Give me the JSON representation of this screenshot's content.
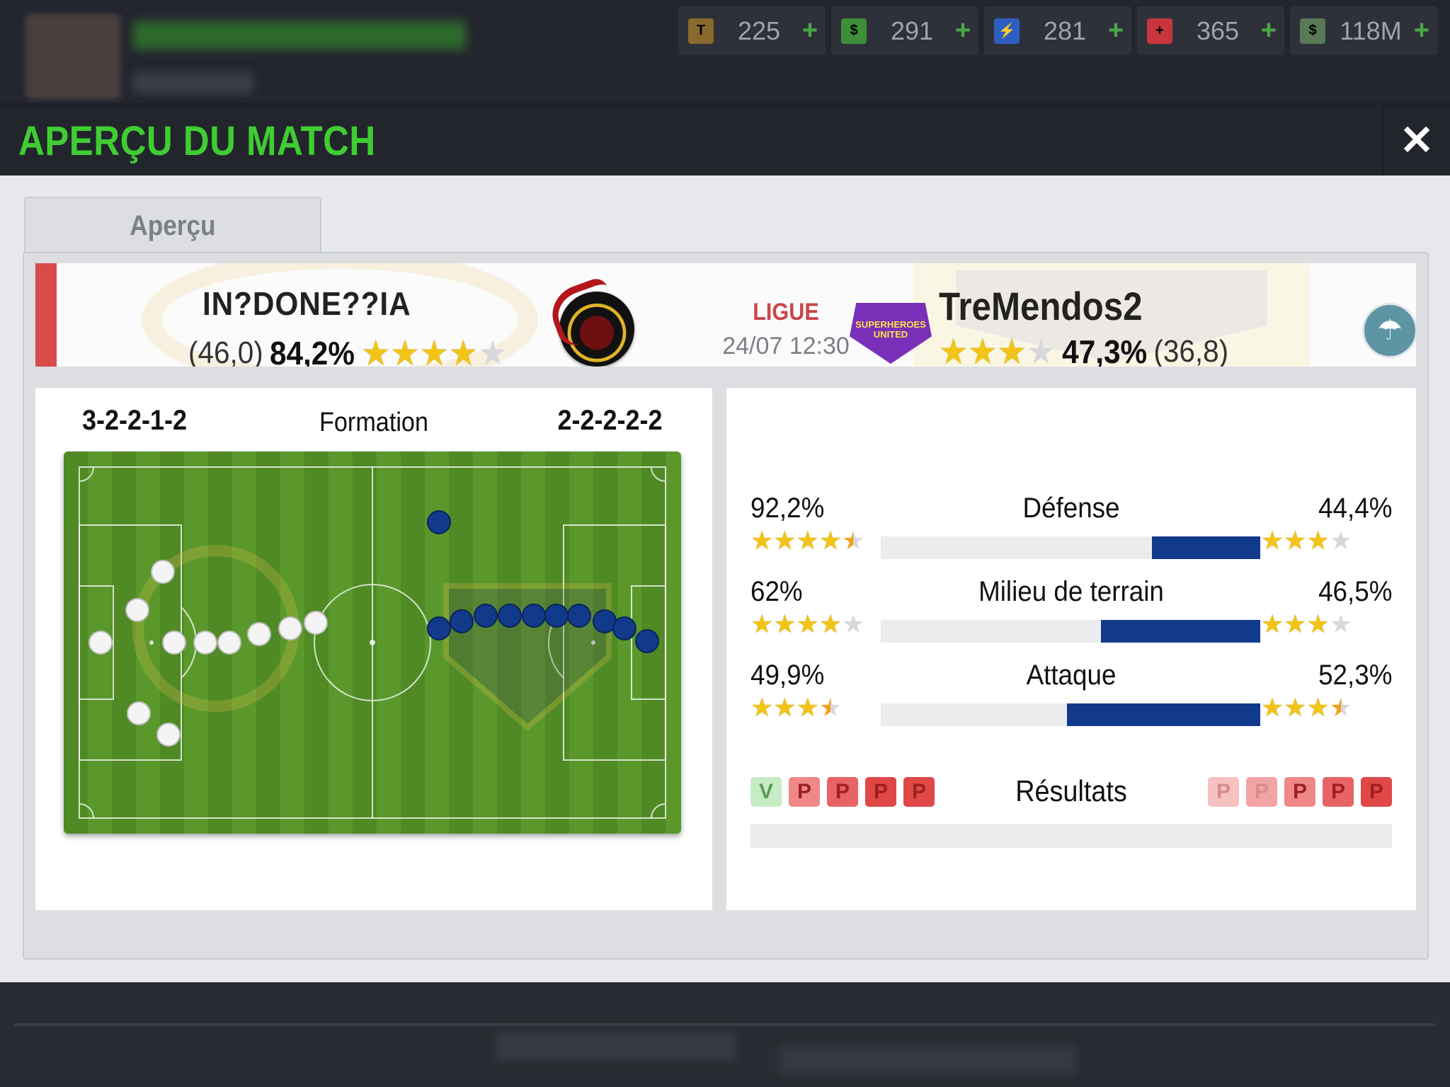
{
  "topbar": {
    "resources": [
      {
        "icon": "token-coin-icon",
        "value": "225",
        "color": "#8a6a2c",
        "glyph": "T"
      },
      {
        "icon": "cash-icon",
        "value": "291",
        "color": "#3f8f3a",
        "glyph": "$"
      },
      {
        "icon": "energy-icon",
        "value": "281",
        "color": "#2e5ec2",
        "glyph": "⚡"
      },
      {
        "icon": "medical-icon",
        "value": "365",
        "color": "#c8363b",
        "glyph": "+"
      },
      {
        "icon": "money-bag-icon",
        "value": "118M",
        "color": "#587a56",
        "glyph": "$"
      }
    ],
    "plus": "+"
  },
  "modal": {
    "title": "APERÇU DU MATCH",
    "close_symbol": "✕",
    "tab_label": "Aperçu"
  },
  "match": {
    "home": {
      "name": "IN?DONE??IA",
      "rating": "(46,0)",
      "percent": "84,2%",
      "stars": 4.0,
      "stars_max": 5,
      "formation": "3-2-2-1-2"
    },
    "competition": "LIGUE",
    "datetime": "24/07 12:30",
    "away": {
      "name": "TreMendos2",
      "logo_text": "SUPERHEROES UNITED",
      "rating": "(36,8)",
      "percent": "47,3%",
      "stars": 3.0,
      "stars_max": 4,
      "formation": "2-2-2-2-2"
    },
    "weather_icon": "rain-cloud-icon"
  },
  "formation_label": "Formation",
  "stats": [
    {
      "label": "Défense",
      "home": "92,2%",
      "away": "44,4%",
      "home_stars": 4.5,
      "home_max": 5,
      "away_stars": 3.0,
      "away_max": 4,
      "away_share": 0.285
    },
    {
      "label": "Milieu de terrain",
      "home": "62%",
      "away": "46,5%",
      "home_stars": 4.0,
      "home_max": 5,
      "away_stars": 3.0,
      "away_max": 4,
      "away_share": 0.42
    },
    {
      "label": "Attaque",
      "home": "49,9%",
      "away": "52,3%",
      "home_stars": 3.5,
      "home_max": 4,
      "away_stars": 3.5,
      "away_max": 4,
      "away_share": 0.51
    }
  ],
  "results": {
    "label": "Résultats",
    "home": [
      "V",
      "P",
      "P",
      "P",
      "P"
    ],
    "away": [
      "P",
      "P",
      "P",
      "P",
      "P"
    ]
  },
  "colors": {
    "accent_green": "#3fcd32",
    "home_red": "#d94a4a",
    "bar_blue": "#123a8a"
  }
}
